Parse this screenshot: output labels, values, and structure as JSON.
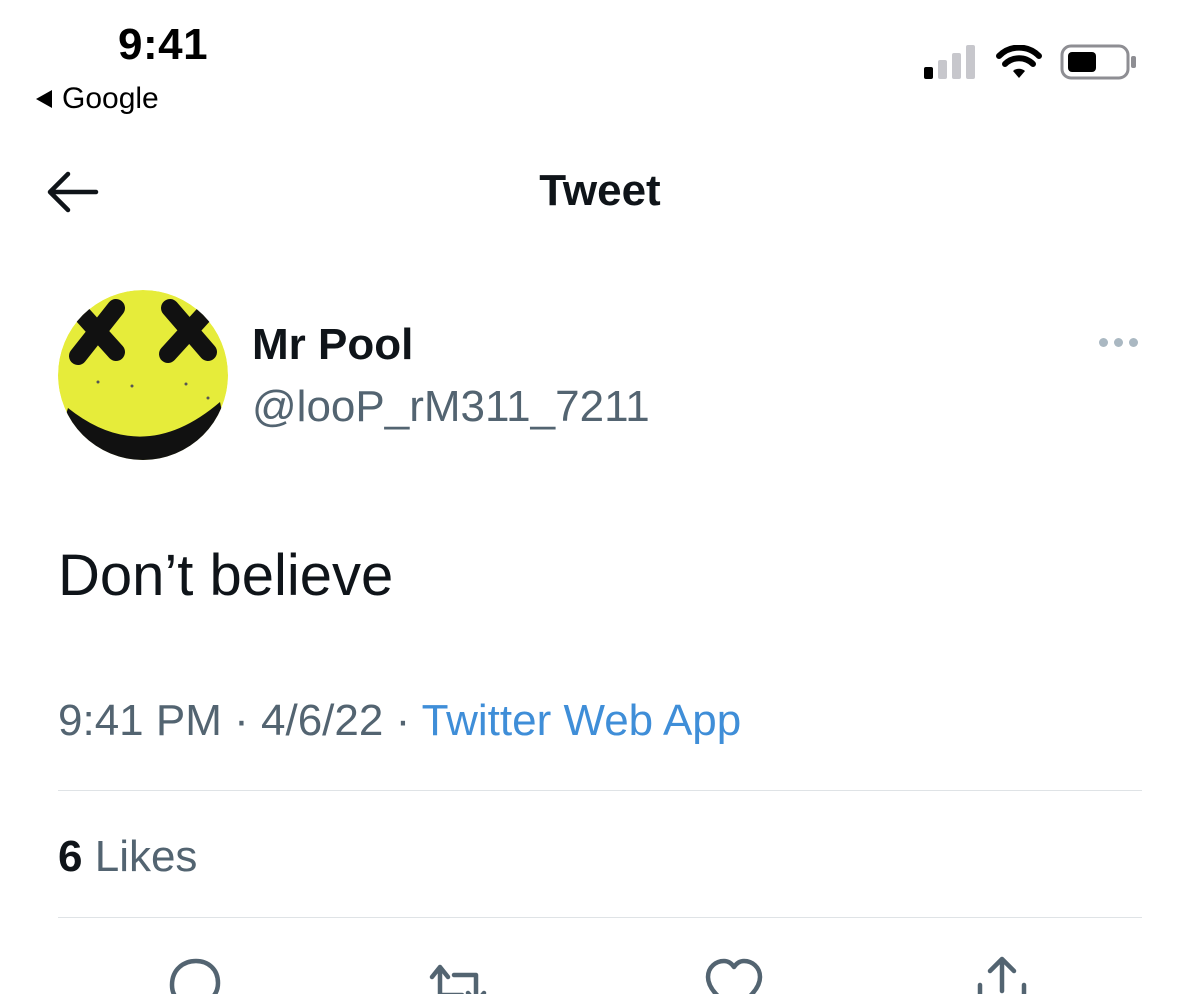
{
  "status_bar": {
    "time": "9:41",
    "back_app_label": "Google",
    "icons": [
      "cellular-signal-icon",
      "wifi-icon",
      "battery-icon"
    ]
  },
  "header": {
    "title": "Tweet",
    "back_icon": "back-arrow-icon"
  },
  "tweet": {
    "author_name": "Mr Pool",
    "author_handle": "@looP_rM311_7211",
    "avatar": "smiley-avatar-image",
    "text": "Don’t believe",
    "time": "9:41 PM",
    "separator": "·",
    "date": "4/6/22",
    "source": "Twitter Web App",
    "likes_count": "6",
    "likes_label": "Likes"
  },
  "actions": [
    "reply-icon",
    "retweet-icon",
    "like-icon",
    "share-icon"
  ],
  "colors": {
    "text_primary": "#0f1419",
    "text_secondary": "#536471",
    "link": "#3f8ed8",
    "divider": "#dfe3e6",
    "avatar_yellow": "#e6ec3a"
  }
}
